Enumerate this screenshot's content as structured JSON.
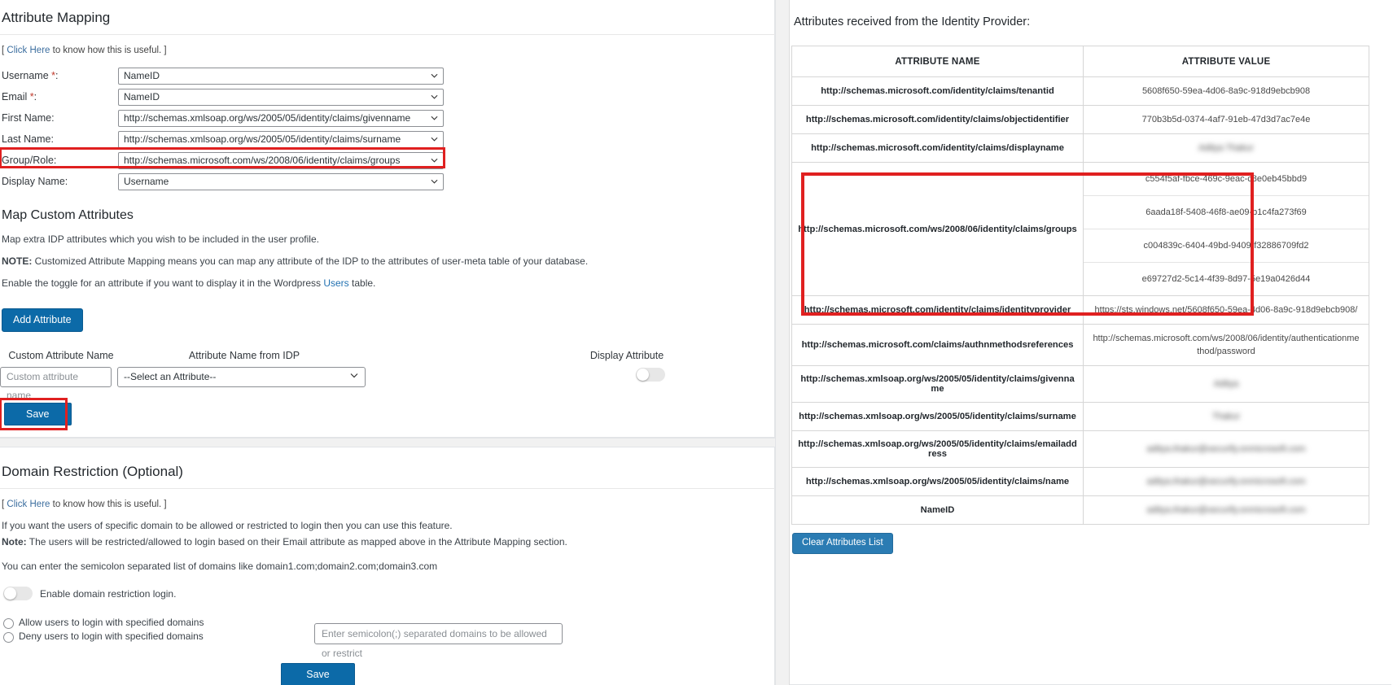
{
  "attribute_mapping": {
    "title": "Attribute Mapping",
    "help_prefix": "[ ",
    "help_link": "Click Here",
    "help_suffix": " to know how this is useful. ]",
    "fields": [
      {
        "label": "Username",
        "required": "*",
        "colon": ":",
        "value": "NameID"
      },
      {
        "label": "Email",
        "required": "*",
        "colon": ":",
        "value": "NameID"
      },
      {
        "label": "First Name:",
        "required": "",
        "value": "http://schemas.xmlsoap.org/ws/2005/05/identity/claims/givenname"
      },
      {
        "label": "Last Name:",
        "required": "",
        "value": "http://schemas.xmlsoap.org/ws/2005/05/identity/claims/surname"
      },
      {
        "label": "Group/Role:",
        "required": "",
        "value": "http://schemas.microsoft.com/ws/2008/06/identity/claims/groups"
      },
      {
        "label": "Display Name:",
        "required": "",
        "value": "Username"
      }
    ]
  },
  "map_custom": {
    "title": "Map Custom Attributes",
    "desc1": "Map extra IDP attributes which you wish to be included in the user profile.",
    "note_bold": "NOTE:",
    "note_rest": " Customized Attribute Mapping means you can map any attribute of the IDP to the attributes of user-meta table of your database.",
    "toggle_note_pre": "Enable the toggle for an attribute if you want to display it in the Wordpress ",
    "toggle_note_link": "Users",
    "toggle_note_post": " table.",
    "add_attribute_label": "Add Attribute",
    "col_custom_attribute_name": "Custom Attribute Name",
    "col_attribute_name_from_idp": "Attribute Name from IDP",
    "col_display_attribute": "Display Attribute",
    "custom_attribute_placeholder": "Custom attribute name",
    "select_attribute_value": "--Select an Attribute--",
    "save_label": "Save"
  },
  "domain_restriction": {
    "title": "Domain Restriction (Optional)",
    "help_prefix": "[ ",
    "help_link": "Click Here",
    "help_suffix": " to know how this is useful. ]",
    "line1": "If you want the users of specific domain to be allowed or restricted to login then you can use this feature.",
    "line2_bold": "Note:",
    "line2_rest": " The users will be restricted/allowed to login based on their Email attribute as mapped above in the Attribute Mapping section.",
    "line3": "You can enter the semicolon separated list of domains like domain1.com;domain2.com;domain3.com",
    "enable_toggle_label": "Enable domain restriction login.",
    "radio_allow": "Allow users to login with specified domains",
    "radio_deny": "Deny users to login with specified domains",
    "domains_placeholder": "Enter semicolon(;) separated domains to be allowed or restrict",
    "save_label": "Save"
  },
  "idp_attributes": {
    "heading": "Attributes received from the Identity Provider:",
    "col_name": "ATTRIBUTE NAME",
    "col_value": "ATTRIBUTE VALUE",
    "clear_button": "Clear Attributes List",
    "rows": [
      {
        "name": "http://schemas.microsoft.com/identity/claims/tenantid",
        "value": "5608f650-59ea-4d06-8a9c-918d9ebcb908",
        "blurred": false
      },
      {
        "name": "http://schemas.microsoft.com/identity/claims/objectidentifier",
        "value": "770b3b5d-0374-4af7-91eb-47d3d7ac7e4e",
        "blurred": false
      },
      {
        "name": "http://schemas.microsoft.com/identity/claims/displayname",
        "value": "Aditya Thakur",
        "blurred": true
      },
      {
        "name": "http://schemas.microsoft.com/ws/2008/06/identity/claims/groups",
        "values": [
          "c554f5af-fbce-469c-9eac-c8e0eb45bbd9",
          "6aada18f-5408-46f8-ae09-b1c4fa273f69",
          "c004839c-6404-49bd-9409-f32886709fd2",
          "e69727d2-5c14-4f39-8d97-5e19a0426d44"
        ],
        "blurred": false,
        "highlighted": true
      },
      {
        "name": "http://schemas.microsoft.com/identity/claims/identityprovider",
        "value": "https://sts.windows.net/5608f650-59ea-4d06-8a9c-918d9ebcb908/",
        "blurred": false
      },
      {
        "name": "http://schemas.microsoft.com/claims/authnmethodsreferences",
        "value": "http://schemas.microsoft.com/ws/2008/06/identity/authenticationmethod/password",
        "blurred": false
      },
      {
        "name": "http://schemas.xmlsoap.org/ws/2005/05/identity/claims/givenname",
        "value": "Aditya",
        "blurred": true
      },
      {
        "name": "http://schemas.xmlsoap.org/ws/2005/05/identity/claims/surname",
        "value": "Thakur",
        "blurred": true
      },
      {
        "name": "http://schemas.xmlsoap.org/ws/2005/05/identity/claims/emailaddress",
        "value": "aditya.thakur@xecurify.onmicrosoft.com",
        "blurred": true
      },
      {
        "name": "http://schemas.xmlsoap.org/ws/2005/05/identity/claims/name",
        "value": "aditya.thakur@xecurify.onmicrosoft.com",
        "blurred": true
      },
      {
        "name": "NameID",
        "value": "aditya.thakur@xecurify.onmicrosoft.com",
        "blurred": true
      }
    ]
  },
  "colors": {
    "primary_button": "#0c6aa8",
    "highlight_red": "#e02020",
    "link": "#2271b1"
  }
}
